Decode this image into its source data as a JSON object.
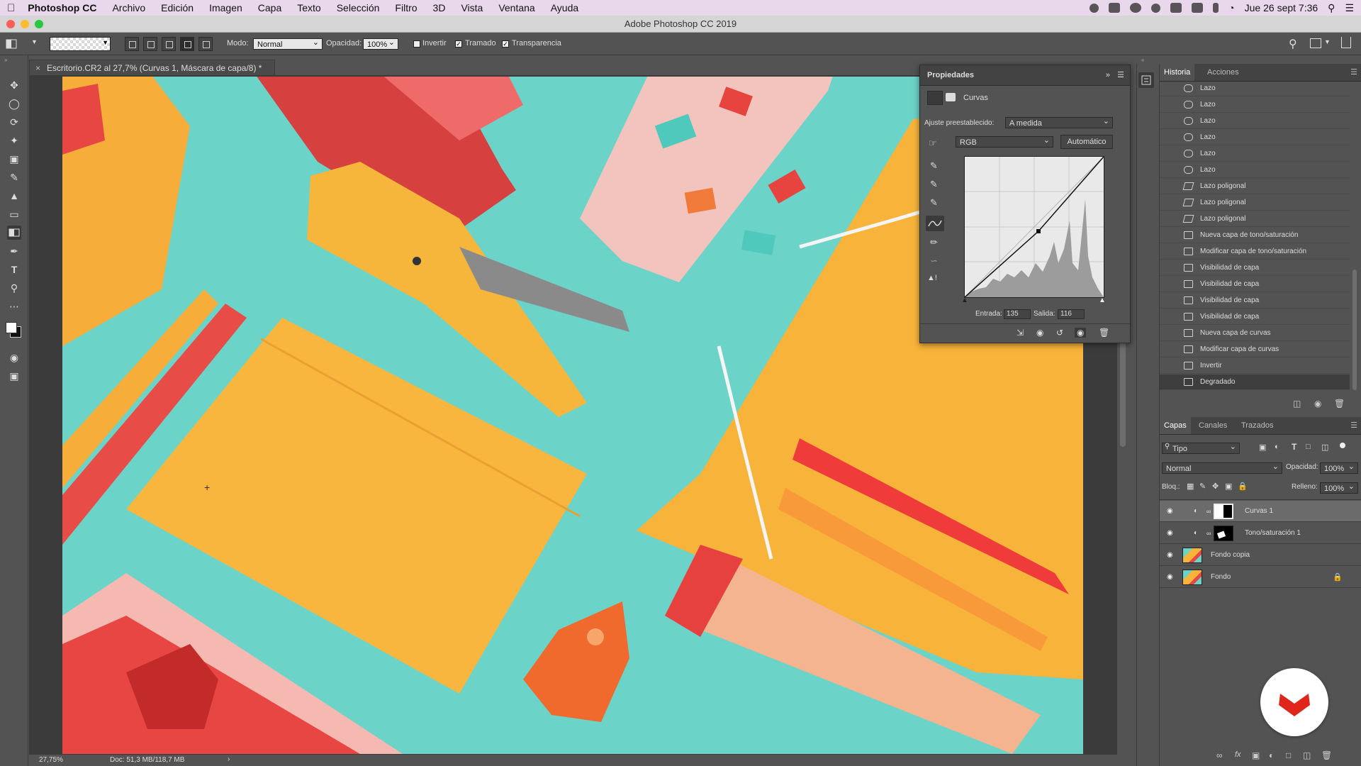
{
  "menubar": {
    "app": "Photoshop CC",
    "items": [
      "Archivo",
      "Edición",
      "Imagen",
      "Capa",
      "Texto",
      "Selección",
      "Filtro",
      "3D",
      "Vista",
      "Ventana",
      "Ayuda"
    ],
    "clock": "Jue 26 sept  7:36"
  },
  "window": {
    "title": "Adobe Photoshop CC 2019"
  },
  "options": {
    "mode_label": "Modo:",
    "mode_value": "Normal",
    "opacity_label": "Opacidad:",
    "opacity_value": "100%",
    "invert_label": "Invertir",
    "dither_label": "Tramado",
    "transparency_label": "Transparencia"
  },
  "document": {
    "tab_title": "Escritorio.CR2 al 27,7% (Curvas 1, Máscara de capa/8) *",
    "zoom": "27,75%",
    "doc_info": "Doc: 51,3 MB/118,7 MB"
  },
  "properties": {
    "title": "Propiedades",
    "adjustment": "Curvas",
    "preset_label": "Ajuste preestablecido:",
    "preset_value": "A medida",
    "channel": "RGB",
    "auto_button": "Automático",
    "input_label": "Entrada:",
    "input_value": "135",
    "output_label": "Salida:",
    "output_value": "116"
  },
  "history": {
    "tabs": [
      "Historia",
      "Acciones"
    ],
    "items": [
      {
        "label": "Lazo",
        "icon": "lasso-icon"
      },
      {
        "label": "Lazo",
        "icon": "lasso-icon"
      },
      {
        "label": "Lazo",
        "icon": "lasso-icon"
      },
      {
        "label": "Lazo",
        "icon": "lasso-icon"
      },
      {
        "label": "Lazo",
        "icon": "lasso-icon"
      },
      {
        "label": "Lazo",
        "icon": "lasso-icon"
      },
      {
        "label": "Lazo poligonal",
        "icon": "polygonal-lasso-icon"
      },
      {
        "label": "Lazo poligonal",
        "icon": "polygonal-lasso-icon"
      },
      {
        "label": "Lazo poligonal",
        "icon": "polygonal-lasso-icon"
      },
      {
        "label": "Nueva capa de tono/saturación",
        "icon": "document-icon"
      },
      {
        "label": "Modificar capa de tono/saturación",
        "icon": "document-icon"
      },
      {
        "label": "Visibilidad de capa",
        "icon": "document-icon"
      },
      {
        "label": "Visibilidad de capa",
        "icon": "document-icon"
      },
      {
        "label": "Visibilidad de capa",
        "icon": "document-icon"
      },
      {
        "label": "Visibilidad de capa",
        "icon": "document-icon"
      },
      {
        "label": "Nueva capa de curvas",
        "icon": "document-icon"
      },
      {
        "label": "Modificar capa de curvas",
        "icon": "document-icon"
      },
      {
        "label": "Invertir",
        "icon": "document-icon"
      },
      {
        "label": "Degradado",
        "icon": "document-icon"
      }
    ]
  },
  "layers": {
    "tabs": [
      "Capas",
      "Canales",
      "Trazados"
    ],
    "filter_value": "Tipo",
    "blend_mode": "Normal",
    "opacity_label": "Opacidad:",
    "opacity_value": "100%",
    "lock_label": "Bloq.:",
    "fill_label": "Relleno:",
    "fill_value": "100%",
    "items": [
      {
        "name": "Curvas 1",
        "selected": true
      },
      {
        "name": "Tono/saturación 1",
        "selected": false
      },
      {
        "name": "Fondo copia",
        "selected": false
      },
      {
        "name": "Fondo",
        "selected": false
      }
    ]
  },
  "colors": {
    "accent_badge": "#e0251b",
    "canvas_teal": "#6cd3c9"
  }
}
